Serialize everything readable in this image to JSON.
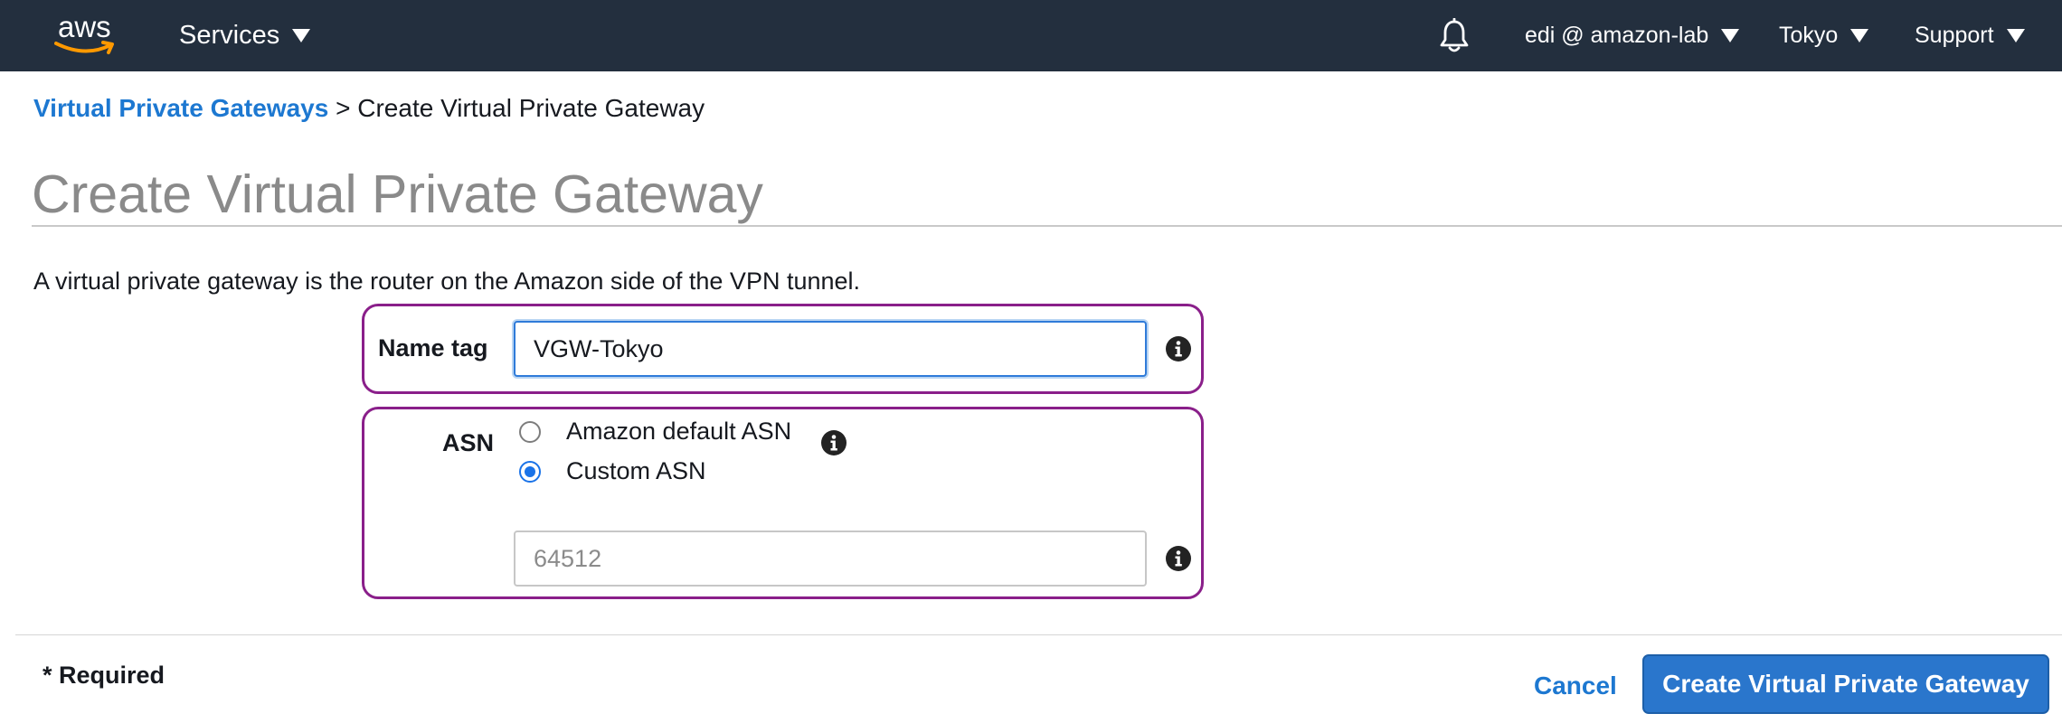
{
  "nav": {
    "logo_text": "aws",
    "services_label": "Services",
    "account_label": "edi @ amazon-lab",
    "region_label": "Tokyo",
    "support_label": "Support",
    "bell_icon": "bell-icon"
  },
  "breadcrumb": {
    "parent_label": "Virtual Private Gateways",
    "separator": ">",
    "current_label": "Create Virtual Private Gateway"
  },
  "page": {
    "title": "Create Virtual Private Gateway",
    "description": "A virtual private gateway is the router on the Amazon side of the VPN tunnel."
  },
  "form": {
    "name_tag": {
      "label": "Name tag",
      "value": "VGW-Tokyo"
    },
    "asn": {
      "label": "ASN",
      "options": [
        {
          "label": "Amazon default ASN",
          "selected": false
        },
        {
          "label": "Custom ASN",
          "selected": true
        }
      ],
      "custom_placeholder": "64512"
    }
  },
  "footer": {
    "required_note": "* Required",
    "cancel_label": "Cancel",
    "submit_label": "Create Virtual Private Gateway"
  },
  "colors": {
    "nav_background": "#232f3e",
    "link": "#1d78d1",
    "primary_button": "#2a76cc",
    "highlight_border": "#8a1f8a"
  }
}
